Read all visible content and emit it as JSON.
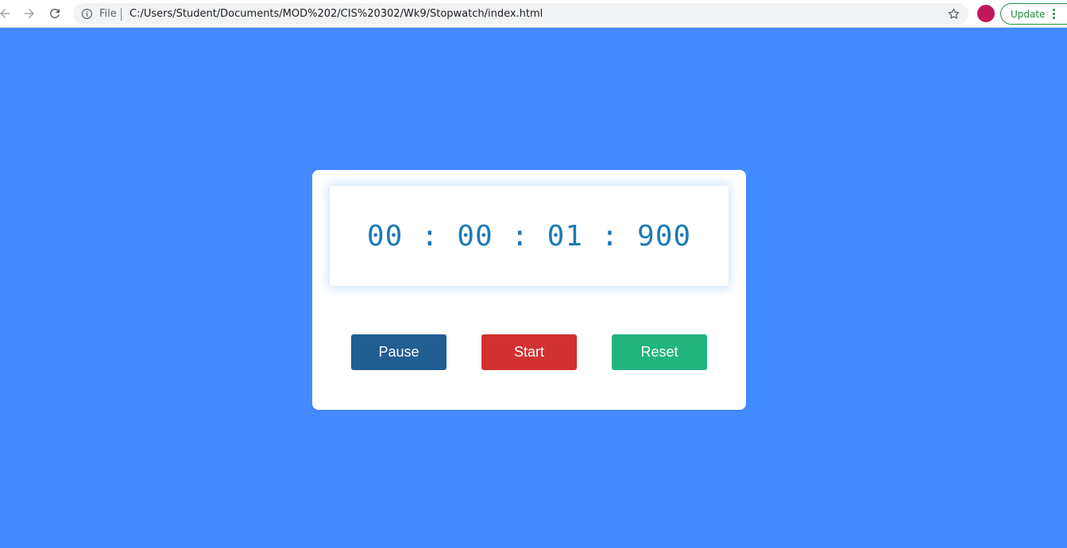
{
  "browser": {
    "scheme_label": "File",
    "url": "C:/Users/Student/Documents/MOD%202/CIS%20302/Wk9/Stopwatch/index.html",
    "update_label": "Update"
  },
  "stopwatch": {
    "time": "00 : 00 : 01 : 900",
    "pause_label": "Pause",
    "start_label": "Start",
    "reset_label": "Reset"
  },
  "colors": {
    "background": "#4389ff",
    "time_text": "#1a7ab8",
    "pause": "#215e92",
    "start": "#d33030",
    "reset": "#21b47d",
    "avatar": "#c2185b",
    "update": "#1e8e3e"
  },
  "icons": [
    "back-arrow-icon",
    "forward-arrow-icon",
    "reload-icon",
    "info-icon",
    "star-icon",
    "kebab-menu-icon"
  ]
}
